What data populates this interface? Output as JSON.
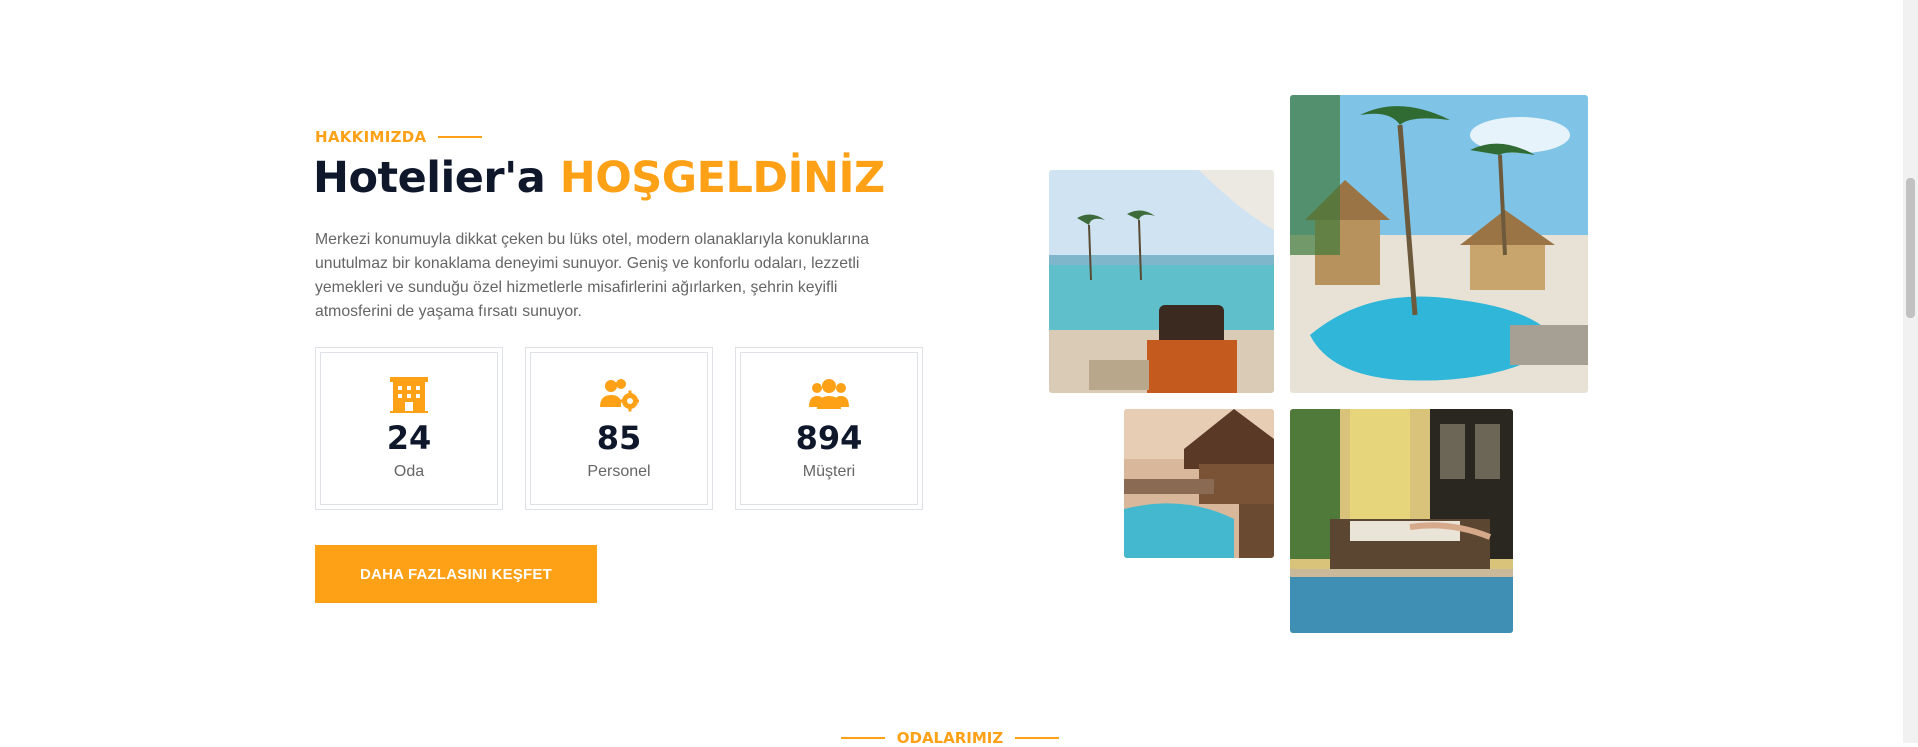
{
  "about": {
    "subtitle": "HAKKIMIZDA",
    "title_plain": "Hotelier'a",
    "title_accent": "HOŞGELDİNİZ",
    "description": "Merkezi konumuyla dikkat çeken bu lüks otel, modern olanaklarıyla konuklarına unutulmaz bir konaklama deneyimi sunuyor. Geniş ve konforlu odaları, lezzetli yemekleri ve sunduğu özel hizmetlerle misafirlerini ağırlarken, şehrin keyifli atmosferini de yaşama fırsatı sunuyor.",
    "stats": [
      {
        "icon": "hotel-icon",
        "value": "24",
        "label": "Oda"
      },
      {
        "icon": "users-cog-icon",
        "value": "85",
        "label": "Personel"
      },
      {
        "icon": "users-icon",
        "value": "894",
        "label": "Müşteri"
      }
    ],
    "cta_label": "DAHA FAZLASINI KEŞFET"
  },
  "gallery": {
    "images": [
      "beach-pool-photo",
      "tropical-resort-pool-photo",
      "sunset-pool-lodge-photo",
      "poolside-lounger-photo"
    ]
  },
  "next_section": {
    "subtitle": "ODALARIMIZ"
  },
  "colors": {
    "primary": "#FEA116",
    "dark": "#0F172B",
    "text": "#666565",
    "border": "#dee2e6"
  }
}
